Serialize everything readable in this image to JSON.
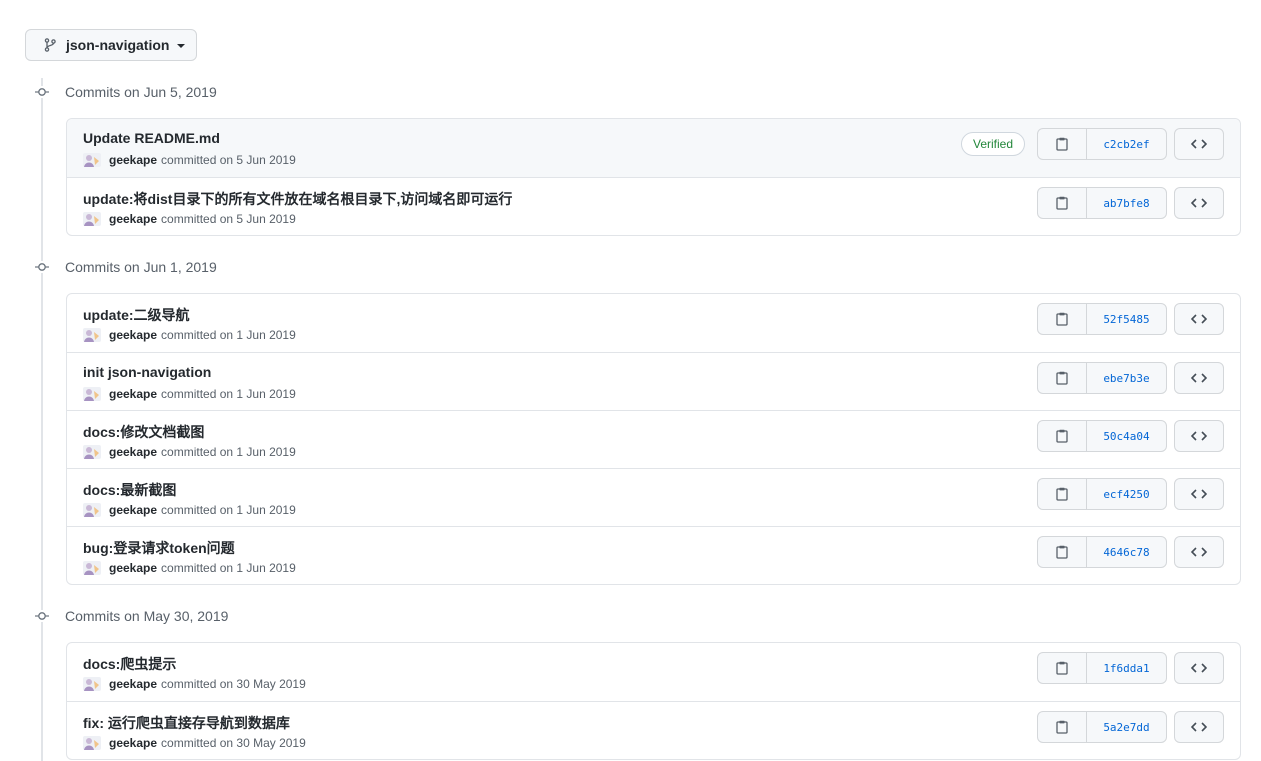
{
  "branch": {
    "name": "json-navigation"
  },
  "icons": {
    "branch": "git-branch-icon",
    "copy": "clipboard-icon",
    "browse": "code-icon",
    "commit": "git-commit-icon"
  },
  "colors": {
    "sha": "#0366d6",
    "verified": "#22863a"
  },
  "groups": [
    {
      "title": "Commits on Jun 5, 2019",
      "commits": [
        {
          "message": "Update README.md",
          "author": "geekape",
          "committed": "committed on 5 Jun 2019",
          "verified": "Verified",
          "sha": "c2cb2ef"
        },
        {
          "message": "update:将dist目录下的所有文件放在域名根目录下,访问域名即可运行",
          "author": "geekape",
          "committed": "committed on 5 Jun 2019",
          "sha": "ab7bfe8"
        }
      ]
    },
    {
      "title": "Commits on Jun 1, 2019",
      "commits": [
        {
          "message": "update:二级导航",
          "author": "geekape",
          "committed": "committed on 1 Jun 2019",
          "sha": "52f5485"
        },
        {
          "message": "init json-navigation",
          "author": "geekape",
          "committed": "committed on 1 Jun 2019",
          "sha": "ebe7b3e"
        },
        {
          "message": "docs:修改文档截图",
          "author": "geekape",
          "committed": "committed on 1 Jun 2019",
          "sha": "50c4a04"
        },
        {
          "message": "docs:最新截图",
          "author": "geekape",
          "committed": "committed on 1 Jun 2019",
          "sha": "ecf4250"
        },
        {
          "message": "bug:登录请求token问题",
          "author": "geekape",
          "committed": "committed on 1 Jun 2019",
          "sha": "4646c78"
        }
      ]
    },
    {
      "title": "Commits on May 30, 2019",
      "commits": [
        {
          "message": "docs:爬虫提示",
          "author": "geekape",
          "committed": "committed on 30 May 2019",
          "sha": "1f6dda1"
        },
        {
          "message": "fix: 运行爬虫直接存导航到数据库",
          "author": "geekape",
          "committed": "committed on 30 May 2019",
          "sha": "5a2e7dd"
        }
      ]
    }
  ]
}
